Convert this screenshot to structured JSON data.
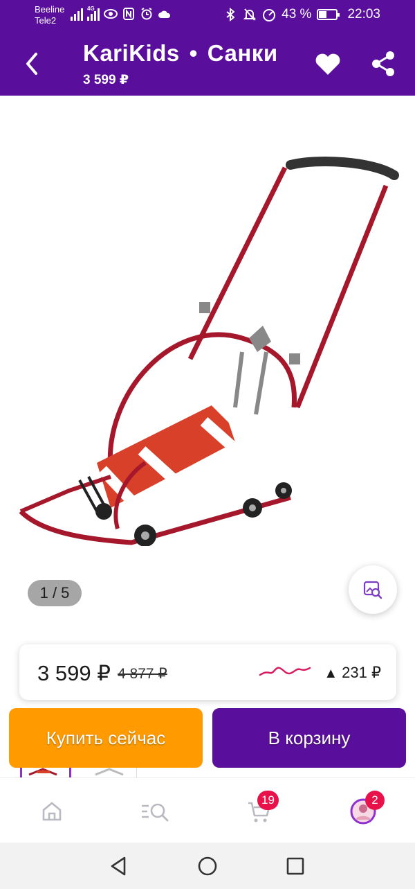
{
  "status_bar": {
    "carrier1": "Beeline",
    "carrier2": "Tele2",
    "network": "4G",
    "battery": "43 %",
    "battery_level": 0.43,
    "time": "22:03"
  },
  "header": {
    "brand": "KariKids",
    "separator": "•",
    "category": "Санки",
    "price": "3 599 ₽"
  },
  "gallery": {
    "counter": "1 / 5"
  },
  "price_card": {
    "current": "3 599 ₽",
    "old": "4 877 ₽",
    "change": "231 ₽",
    "change_direction": "up"
  },
  "actions": {
    "buy_now": "Купить сейчас",
    "add_to_cart": "В корзину"
  },
  "nav": {
    "cart_count": "19",
    "profile_count": "2"
  },
  "colors": {
    "brand_purple": "#5a0f9c",
    "buy_orange": "#ff9b00",
    "badge_red": "#e8114a",
    "trend_line": "#d81b60"
  }
}
